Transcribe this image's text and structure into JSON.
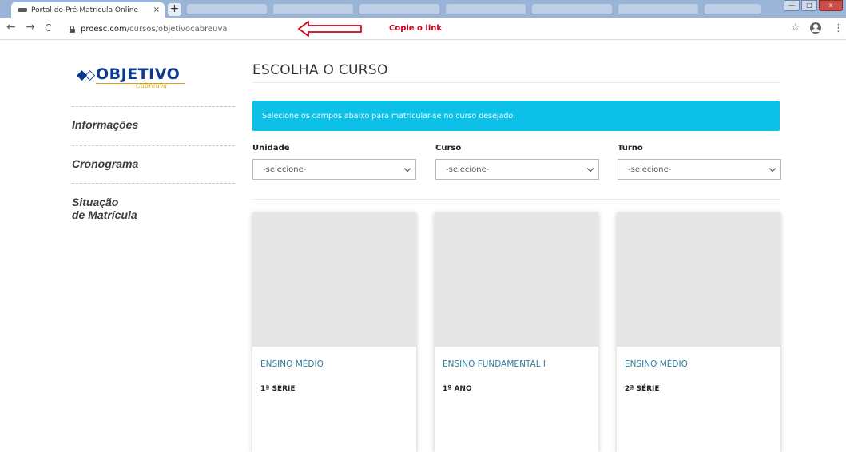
{
  "browser": {
    "tab_title": "Portal de Pré-Matrícula Online",
    "tab_close": "×",
    "new_tab": "+",
    "nav_back": "←",
    "nav_forward": "→",
    "nav_reload": "C",
    "url_host": "proesc.com",
    "url_path": "/cursos/objetivocabreuva",
    "annotation": "Copie o link",
    "bookmark": "☆",
    "menu": "⋮",
    "win_minimize": "—",
    "win_maximize": "□",
    "win_close": "x"
  },
  "logo": {
    "mark": "◆◇",
    "text": "OBJETIVO",
    "script": "Cabreuva"
  },
  "sidebar": {
    "items": [
      {
        "label": "Informações"
      },
      {
        "label": "Cronograma"
      },
      {
        "label_line1": "Situação",
        "label_line2": "de Matrícula"
      }
    ]
  },
  "main": {
    "heading": "ESCOLHA O CURSO",
    "alert": "Selecione os campos abaixo para matricular-se no curso desejado.",
    "filters": [
      {
        "label": "Unidade",
        "value": "-selecione-"
      },
      {
        "label": "Curso",
        "value": "-selecione-"
      },
      {
        "label": "Turno",
        "value": "-selecione-"
      }
    ],
    "cards": [
      {
        "level": "ENSINO MÉDIO",
        "grade": "1ª SÉRIE"
      },
      {
        "level": "ENSINO FUNDAMENTAL I",
        "grade": "1º ANO"
      },
      {
        "level": "ENSINO MÉDIO",
        "grade": "2ª SÉRIE"
      }
    ]
  },
  "colors": {
    "alert_bg": "#0cc0e8",
    "logo_blue": "#0b3a8f",
    "logo_gold": "#d4a30f",
    "card_level": "#2f7d9e",
    "annotation_red": "#d0021b"
  }
}
